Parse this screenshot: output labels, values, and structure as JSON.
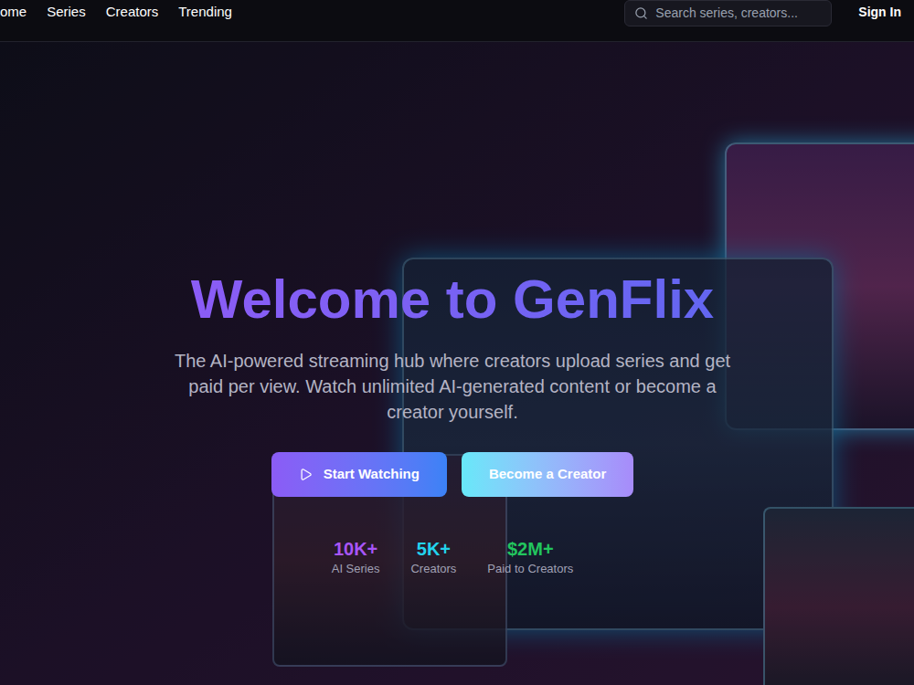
{
  "nav": {
    "items": [
      {
        "label": "ome",
        "selected": false
      },
      {
        "label": "Series",
        "selected": false
      },
      {
        "label": "Creators",
        "selected": false
      },
      {
        "label": "Trending",
        "selected": false
      }
    ]
  },
  "search": {
    "placeholder": "Search series, creators..."
  },
  "sign_in": "Sign In",
  "hero": {
    "title": "Welcome to GenFlix",
    "subtitle": "The AI-powered streaming hub where creators upload series and get paid per view. Watch unlimited AI-generated content or become a creator yourself.",
    "buttons": [
      {
        "label": "Start Watching",
        "kind": "primary"
      },
      {
        "label": "Become a Creator",
        "kind": "secondary"
      }
    ]
  },
  "stats": [
    {
      "value": "10K+",
      "label": "AI Series",
      "color": "#a855f7"
    },
    {
      "value": "5K+",
      "label": "Creators",
      "color": "#22d3ee"
    },
    {
      "value": "$2M+",
      "label": "Paid to Creators",
      "color": "#22c55e"
    }
  ]
}
